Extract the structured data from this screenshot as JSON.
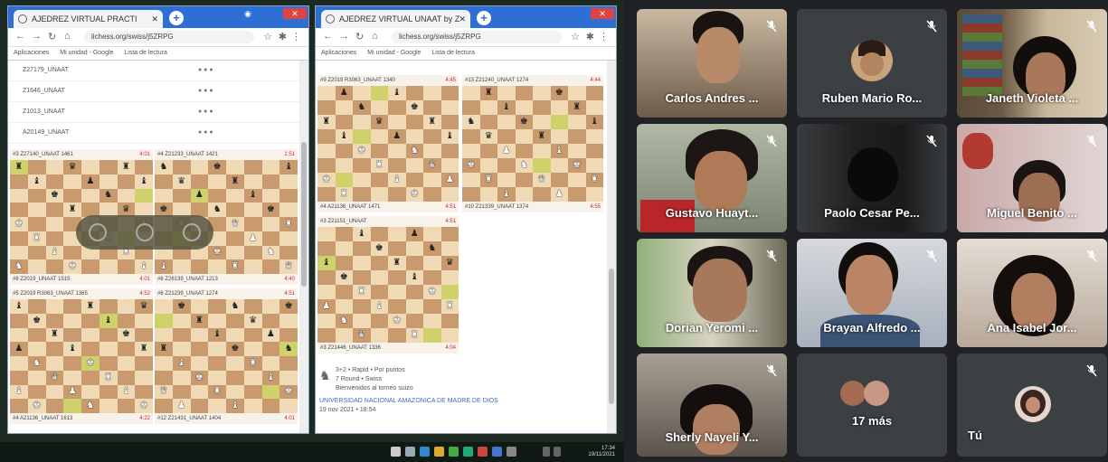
{
  "browser1": {
    "tab_title": "AJEDREZ VIRTUAL PRACTI",
    "url": "lichess.org/swiss/j5ZRPG",
    "bookmarks": [
      "Aplicaciones",
      "Mi unidad - Google",
      "Lista de lectura"
    ],
    "list_rows": [
      "Z27179_UNAAT",
      "Z1646_UNAAT",
      "Z1013_UNAAT",
      "A20149_UNAAT"
    ],
    "boards": [
      {
        "top": "#3 Z27140_UNAAT 1461",
        "top_r": "4:01",
        "bottom": "#8 Z2019_UNAAT 1515",
        "bottom_r": "4:01"
      },
      {
        "top": "#4 Z21233_UNAAT 1421",
        "top_r": "1:51",
        "bottom": "#6 Z26139_UNAAT 1213",
        "bottom_r": "4:40"
      },
      {
        "top": "#5 Z2019 R3063_UNAAT 1365",
        "top_r": "4:52",
        "bottom": "#4 A21136_UNAAT 1613",
        "bottom_r": "4:22"
      },
      {
        "top": "#6 Z21239_UNAAT 1274",
        "top_r": "4:51",
        "bottom": "#12 Z21431_UNAAT 1404",
        "bottom_r": "4:01"
      }
    ]
  },
  "browser2": {
    "tab_title": "AJEDREZ VIRTUAL UNAAT by Z",
    "url": "lichess.org/swiss/j5ZRPG",
    "bookmarks": [
      "Aplicaciones",
      "Mi unidad - Google",
      "Lista de lectura"
    ],
    "boards": [
      {
        "top": "#9 Z2019 R3063_UNAAT 1340",
        "top_r": "4:45",
        "bottom": "#4 A21136_UNAAT 1471",
        "bottom_r": "4:51"
      },
      {
        "top": "#13 Z21240_UNAAT 1274",
        "top_r": "4:44",
        "bottom": "#10 Z21339_UNAAT 1374",
        "bottom_r": "4:55"
      },
      {
        "top": "#3 Z21151_UNAAT",
        "top_r": "4:51",
        "bottom": "#3 Z21446_UNAAT 1336",
        "bottom_r": "4:04"
      }
    ],
    "info_lines": [
      "3+2 • Rapid • Por puntos",
      "7 Round • Swiss",
      "Bienvenidos al torneo suizo",
      "UNIVERSIDAD NACIONAL AMAZONICA DE MADRE DE DIOS",
      "19 nov 2021 • 18:54"
    ]
  },
  "taskbar": {
    "time": "17:34",
    "date": "19/11/2021"
  },
  "meet": {
    "participants": [
      {
        "name": "Carlos Andres ...",
        "muted": true
      },
      {
        "name": "Ruben Mario Ro...",
        "muted": true
      },
      {
        "name": "Janeth Violeta ...",
        "muted": true
      },
      {
        "name": "Gustavo Huayt...",
        "muted": true
      },
      {
        "name": "Paolo Cesar Pe...",
        "muted": true
      },
      {
        "name": "Miguel Benito ...",
        "muted": true
      },
      {
        "name": "Dorian Yeromi ...",
        "muted": true
      },
      {
        "name": "Brayan Alfredo ...",
        "muted": true
      },
      {
        "name": "Ana Isabel Jor...",
        "muted": true
      },
      {
        "name": "Sherly Nayeli Y...",
        "muted": true
      },
      {
        "name": "17 más",
        "muted": false
      },
      {
        "name": "Tú",
        "muted": true
      }
    ]
  },
  "colors": {
    "accent": "#2e6fd6",
    "light_square": "#f0d9b5",
    "dark_square": "#c99a6e",
    "meet_bg": "#202124",
    "tile_bg": "#3c4043"
  }
}
